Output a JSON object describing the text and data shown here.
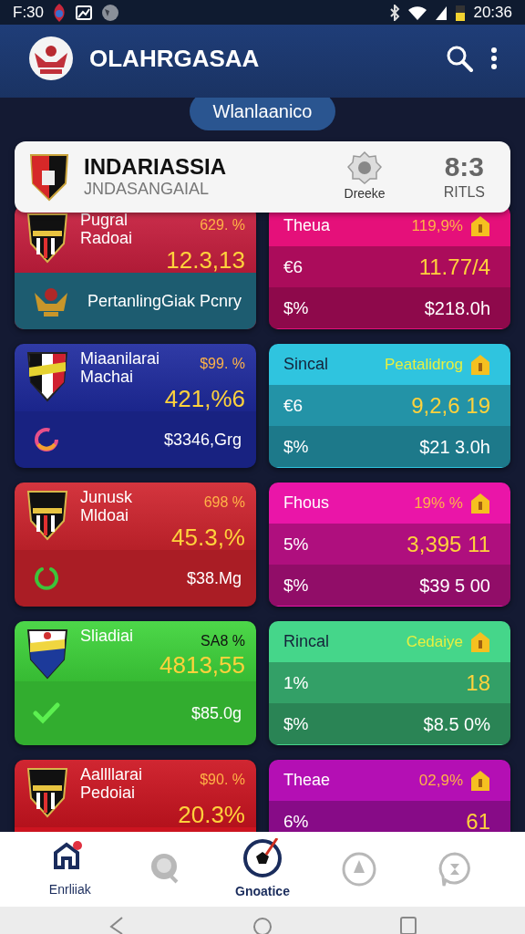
{
  "status_bar": {
    "left_time": "F:30",
    "time": "20:36"
  },
  "app_bar": {
    "title": "OLAHRGASAA"
  },
  "filter_chip": {
    "label": "Wlanlaanico"
  },
  "featured": {
    "team": "INDARIASSIA",
    "subtitle": "JNDASANGAIAL",
    "badge_label": "Dreeke",
    "score": "8:3",
    "score_label": "RITLS"
  },
  "matches": [
    {
      "left": {
        "color": "#c81e3e",
        "kind": "striped",
        "name": "Pugral\nRadoai",
        "percent": "629. %",
        "value": "12.3,13",
        "footer": {
          "kind": "emblem",
          "text": "PertanlingGiak Pcnry"
        }
      },
      "right": {
        "color": "#e5107a",
        "title": "Theua",
        "percent": "119,9%",
        "row2_label": "€6",
        "row2_value": "11.77/4",
        "row3_label": "$%",
        "row3_value": "$218.0h"
      }
    },
    {
      "left": {
        "color": "#1e2a9e",
        "kind": "tricolor",
        "name": "Miaanilarai\nMachai",
        "percent": "$99. %",
        "value": "421,%6",
        "footer": {
          "kind": "ring",
          "text": "$3346,Grg"
        }
      },
      "right": {
        "color": "#2fc4df",
        "title": "Sincal",
        "percent": "Peatalidrog",
        "row2_label": "€6",
        "row2_value": "9,2,6 19",
        "row3_label": "$%",
        "row3_value": "$21 3.0h"
      }
    },
    {
      "left": {
        "color": "#d0242e",
        "kind": "striped",
        "name": "Junusk\nMldoai",
        "percent": "698 %",
        "value": "45.3,%",
        "footer": {
          "kind": "spinner",
          "text": "$38.Mg"
        }
      },
      "right": {
        "color": "#ea15a8",
        "title": "Fhous",
        "percent": "19% %",
        "row2_label": "5%",
        "row2_value": "3,395 11",
        "row3_label": "$%",
        "row3_value": "$39 5 00"
      }
    },
    {
      "left": {
        "color": "#3ed43a",
        "kind": "blue",
        "name": "Sliadiai",
        "percent": "SA8 %",
        "value": "4813,55",
        "footer": {
          "kind": "check",
          "text": "$85.0g"
        }
      },
      "right": {
        "color": "#45d68a",
        "title": "Rincal",
        "percent": "Cedaiye",
        "row2_label": "1%",
        "row2_value": "18",
        "row3_label": "$%",
        "row3_value": "$8.5 0%"
      }
    },
    {
      "left": {
        "color": "#cc1420",
        "kind": "striped",
        "name": "Aallllarai\nPedoiai",
        "percent": "$90. %",
        "value": "20.3%"
      },
      "right": {
        "color": "#b40fb4",
        "title": "Theae",
        "percent": "02,9%",
        "row2_label": "6%",
        "row2_value": "61"
      }
    }
  ],
  "bottom_nav": [
    {
      "kind": "home",
      "label": "Enrliiak",
      "selected": false
    },
    {
      "kind": "search",
      "selected": false
    },
    {
      "kind": "ball",
      "label": "Gnoatice",
      "selected": true
    },
    {
      "kind": "bulb",
      "selected": false
    },
    {
      "kind": "chat",
      "selected": false
    }
  ]
}
